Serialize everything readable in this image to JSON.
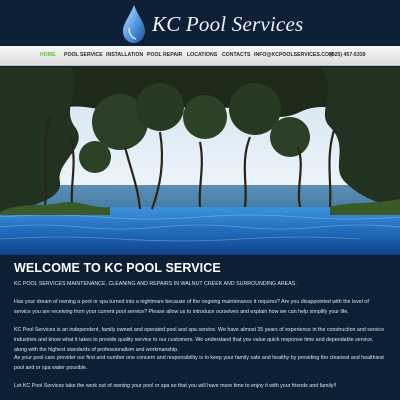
{
  "header": {
    "logo_text": "KC Pool Services"
  },
  "nav": {
    "items": [
      {
        "label": "HOME",
        "active": true
      },
      {
        "label": "POOL SERVICE"
      },
      {
        "label": "INSTALLATION"
      },
      {
        "label": "POOL REPAIR"
      },
      {
        "label": "LOCATIONS"
      },
      {
        "label": "CONTACTS"
      },
      {
        "label": "INFO@KCPOOLSERVICES.COM"
      },
      {
        "label": "(925) 457-5339"
      }
    ]
  },
  "hero": {
    "alt": "Infinity pool overlooking the ocean framed by trees"
  },
  "content": {
    "heading": "WELCOME TO KC POOL SERVICE",
    "paragraphs": [
      "KC POOL SERVICES  MAINTENANCE, CLEANING AND REPAIRS IN WALNUT CREEK AND SURROUNDING AREAS.",
      "Has your dream of owning a pool or spa turned into a nightmare because of the ongoing maintenance it requires? Are you disappointed with the level of service you are receiving from your current pool service? Please allow us to introduce ourselves and explain how we can help simplify your life.",
      "KC Pool Services is an independent, family owned and operated pool and spa service. We have almost 35 years of experience in the construction and service industries and know what it takes to provide quality service to our customers. We understand that you value quick response time and dependable service, along with the highest standards of professionalism and workmanship.",
      "As your pool care provider our first and number one concern and responsibility is to keep your family safe and healthy by providing the cleanest and healthiest pool and or spa water possible.",
      "Let KC Pool Services take the work out of owning your pool or spa so that you will have more time to enjoy it with your friends and family!!"
    ]
  },
  "colors": {
    "page_background": "#0c1f35",
    "nav_active": "#5fbf3c",
    "pool_water": "#1f6fc4"
  }
}
